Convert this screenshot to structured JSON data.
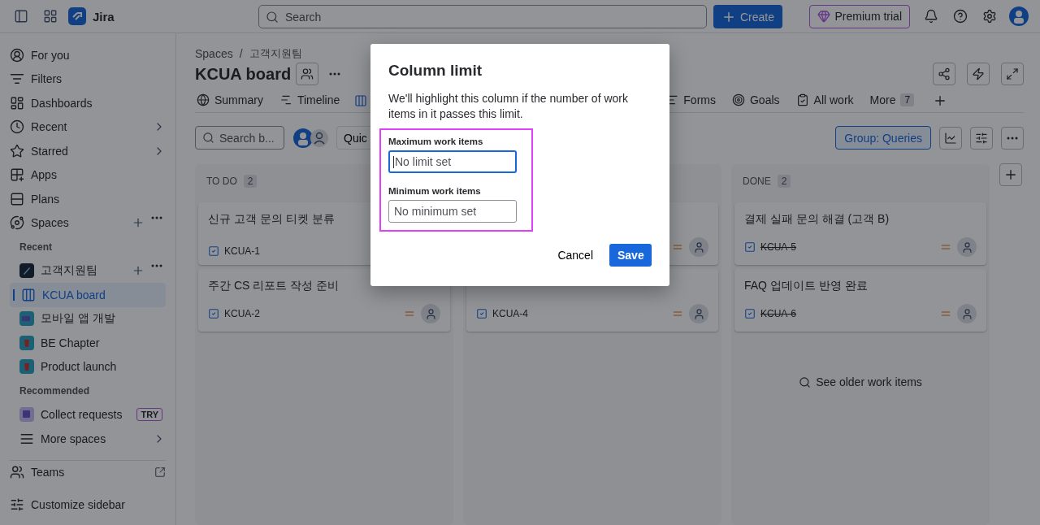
{
  "topbar": {
    "product": "Jira",
    "search_placeholder": "Search",
    "create_label": "Create",
    "premium_label": "Premium trial"
  },
  "sidebar": {
    "nav": [
      {
        "label": "For you"
      },
      {
        "label": "Filters"
      },
      {
        "label": "Dashboards"
      },
      {
        "label": "Recent",
        "chevron": true
      },
      {
        "label": "Starred",
        "chevron": true
      },
      {
        "label": "Apps"
      },
      {
        "label": "Plans"
      },
      {
        "label": "Spaces",
        "actions": true
      }
    ],
    "sections": [
      {
        "heading": "Recent",
        "items": [
          {
            "label": "고객지원팀",
            "actions": true,
            "children": [
              {
                "label": "KCUA board",
                "selected": true
              }
            ]
          },
          {
            "label": "모바일 앱 개발",
            "actions": false
          },
          {
            "label": "BE Chapter",
            "actions": false
          },
          {
            "label": "Product launch",
            "actions": false
          }
        ]
      },
      {
        "heading": "Recommended",
        "items": [
          {
            "label": "Collect requests",
            "actions": false,
            "badge": "TRY"
          }
        ]
      }
    ],
    "more_spaces": "More spaces",
    "footer": [
      {
        "label": "Teams",
        "external_link": true
      },
      {
        "label": "Customize sidebar"
      }
    ]
  },
  "board": {
    "breadcrumb": [
      "Spaces",
      "고객지원팀"
    ],
    "breadcrumb_separator": "/",
    "title": "KCUA board",
    "tabs": [
      {
        "kind": "tab",
        "label": "Summary",
        "selected": false
      },
      {
        "kind": "tab",
        "label": "Timeline",
        "selected": false
      },
      {
        "kind": "covered"
      },
      {
        "kind": "tab",
        "label": "Forms",
        "selected": false
      },
      {
        "kind": "tab",
        "label": "Goals",
        "selected": false
      },
      {
        "kind": "tab",
        "label": "All work",
        "selected": false
      },
      {
        "kind": "tab",
        "label": "More",
        "count": "7",
        "selected": false
      }
    ],
    "search_value": "Search b...",
    "quick_filters": "Quic",
    "group_by": "Group: Queries",
    "columns": [
      {
        "title": "TO DO",
        "count": "2",
        "cards": [
          {
            "kind": "left",
            "title": "신규 고객 문의 티켓 분류",
            "key": "KCUA-1",
            "done": false
          },
          {
            "kind": "card",
            "title": "주간 CS 리포트 작성 준비",
            "key": "KCUA-2",
            "done": false
          }
        ]
      },
      {
        "cards": [
          {
            "kind": "covered"
          },
          {
            "kind": "card",
            "key": "KCUA-4",
            "done": false
          }
        ]
      },
      {
        "title": "DONE",
        "count": "2",
        "cards": [
          {
            "kind": "card",
            "title": "결제 실패 문의 해결 (고객 B)",
            "key": "KCUA-5",
            "done": true
          },
          {
            "kind": "card",
            "title": "FAQ 업데이트 반영 완료",
            "key": "KCUA-6",
            "done": true
          }
        ],
        "footer": "See older work items"
      }
    ]
  },
  "modal": {
    "title": "Column limit",
    "description": "We'll highlight this column if the number of work items in it passes this limit.",
    "fields": [
      {
        "label": "Maximum work items",
        "placeholder": "No limit set",
        "focused": true
      },
      {
        "label": "Minimum work items",
        "placeholder": "No minimum set",
        "focused": false
      }
    ],
    "cancel": "Cancel",
    "save": "Save"
  }
}
